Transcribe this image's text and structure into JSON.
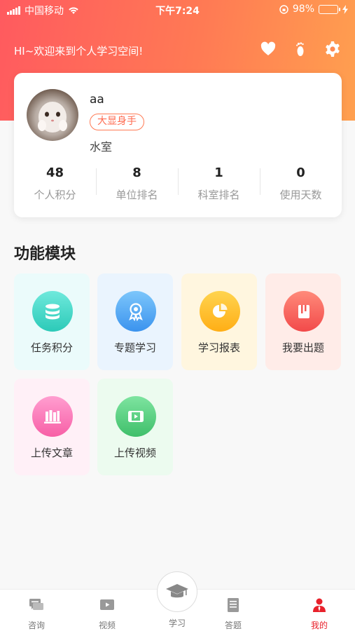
{
  "status_bar": {
    "carrier": "中国移动",
    "time": "下午7:24",
    "battery": "98%"
  },
  "header": {
    "welcome": "HI~欢迎来到个人学习空间!",
    "icons": [
      "heart-icon",
      "footprint-icon",
      "gear-icon"
    ]
  },
  "profile": {
    "username": "aa",
    "badge": "大显身手",
    "department": "水室",
    "stats": [
      {
        "value": "48",
        "label": "个人积分"
      },
      {
        "value": "8",
        "label": "单位排名"
      },
      {
        "value": "1",
        "label": "科室排名"
      },
      {
        "value": "0",
        "label": "使用天数"
      }
    ]
  },
  "modules": {
    "title": "功能模块",
    "items": [
      {
        "label": "任务积分",
        "icon": "database-icon",
        "color": "#3ed6c6"
      },
      {
        "label": "专题学习",
        "icon": "award-icon",
        "color": "#46a6f3"
      },
      {
        "label": "学习报表",
        "icon": "pie-chart-icon",
        "color": "#ffbe21"
      },
      {
        "label": "我要出题",
        "icon": "book-icon",
        "color": "#ff5b5b"
      },
      {
        "label": "上传文章",
        "icon": "books-icon",
        "color": "#ff6fb1"
      },
      {
        "label": "上传视频",
        "icon": "film-icon",
        "color": "#4fd07c"
      }
    ]
  },
  "tabbar": {
    "items": [
      {
        "label": "咨询",
        "icon": "chat-icon"
      },
      {
        "label": "视频",
        "icon": "video-icon"
      },
      {
        "label": "学习",
        "icon": "graduation-cap-icon"
      },
      {
        "label": "答题",
        "icon": "notebook-icon"
      },
      {
        "label": "我的",
        "icon": "user-icon",
        "active": true
      }
    ],
    "active_color": "#e8212b"
  }
}
